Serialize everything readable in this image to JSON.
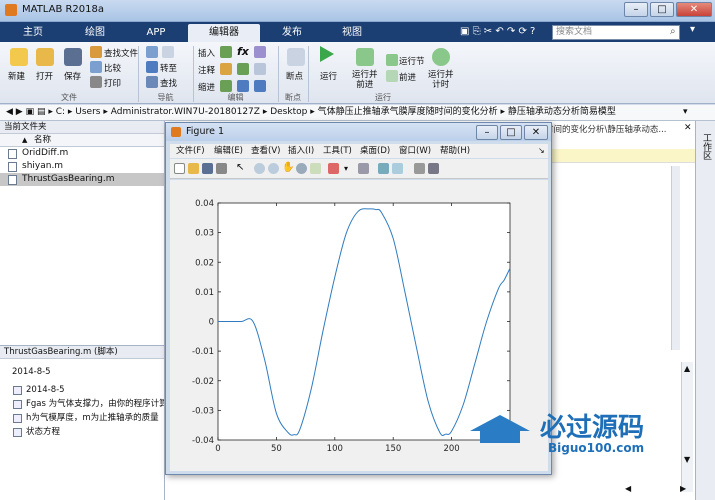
{
  "app": {
    "title": "MATLAB R2018a",
    "window_buttons": [
      "–",
      "□",
      "✕"
    ]
  },
  "tabs": [
    "主页",
    "绘图",
    "APP",
    "编辑器",
    "发布",
    "视图"
  ],
  "active_tab": "编辑器",
  "search": {
    "placeholder": "搜索文档"
  },
  "ribbon": {
    "file_group": {
      "new": "新建",
      "open": "打开",
      "save": "保存",
      "find_files": "查找文件",
      "compare": "比较",
      "print": "打印",
      "label": "文件"
    },
    "nav_group": {
      "goto": "转至",
      "find": "查找",
      "label": "导航"
    },
    "edit_group": {
      "insert": "插入",
      "comment": "注释",
      "indent": "缩进",
      "fx": "fx",
      "label": "编辑"
    },
    "breakpoint_group": {
      "breakpoints": "断点",
      "label": "断点"
    },
    "run_group": {
      "run": "运行",
      "run_and_advance": "运行并\n前进",
      "run_section": "运行节",
      "advance": "前进",
      "run_and_time": "运行并\n计时",
      "label": "运行"
    }
  },
  "address": {
    "segments": [
      "C:",
      "Users",
      "Administrator.WIN7U-20180127Z",
      "Desktop",
      "气体静压止推轴承气膜厚度随时间的变化分析",
      "静压轴承动态分析简易模型"
    ]
  },
  "current_folder": {
    "title": "当前文件夹",
    "column_name": "名称",
    "column_sort": "▲",
    "files": [
      {
        "name": "OridDiff.m",
        "selected": false
      },
      {
        "name": "shiyan.m",
        "selected": false
      },
      {
        "name": "ThrustGasBearing.m",
        "selected": true
      }
    ]
  },
  "details": {
    "title": "ThrustGasBearing.m  (脚本)",
    "first_line": "2014-8-5",
    "items": [
      "2014-8-5",
      "Fgas 为气体支撑力，由你的程序计算出",
      "h为气模厚度，m为止推轴承的质量",
      "状态方程"
    ]
  },
  "editor_tab_text": "时间的变化分析\\静压轴承动态...",
  "side_label": "工作区",
  "figure": {
    "title": "Figure 1",
    "menu": [
      "文件(F)",
      "编辑(E)",
      "查看(V)",
      "插入(I)",
      "工具(T)",
      "桌面(D)",
      "窗口(W)",
      "帮助(H)"
    ],
    "toolbar_icons": [
      "new-figure-icon",
      "open-icon",
      "save-icon",
      "print-icon",
      "select-icon",
      "zoom-in-icon",
      "zoom-out-icon",
      "pan-icon",
      "rotate-icon",
      "data-cursor-icon",
      "brush-icon",
      "link-icon",
      "colorbar-icon",
      "legend-icon",
      "hide-tools-icon",
      "show-tools-icon"
    ]
  },
  "chart_data": {
    "type": "line",
    "title": "",
    "xlabel": "",
    "ylabel": "",
    "xlim": [
      0,
      250
    ],
    "ylim": [
      -0.04,
      0.04
    ],
    "xticks": [
      0,
      50,
      100,
      150,
      200
    ],
    "yticks": [
      0.04,
      0.03,
      0.02,
      0.01,
      0,
      -0.01,
      -0.02,
      -0.03,
      -0.04
    ],
    "ytick_labels": [
      "0.04",
      "0.03",
      "0.02",
      "0.01",
      "0",
      "-0.01",
      "-0.02",
      "-0.03",
      "-0.04"
    ],
    "grid": false,
    "series": [
      {
        "color": "#2f7bbf",
        "x": [
          0,
          10,
          20,
          30,
          40,
          50,
          60,
          65,
          70,
          80,
          90,
          100,
          110,
          120,
          130,
          135,
          140,
          150,
          160,
          170,
          180,
          190,
          195,
          200,
          210,
          220,
          230,
          240,
          245,
          250
        ],
        "y": [
          0,
          0,
          0,
          0,
          -0.013,
          -0.031,
          -0.0375,
          -0.0382,
          -0.0365,
          -0.0225,
          -0.003,
          0.015,
          0.03,
          0.0372,
          0.038,
          0.0378,
          0.0368,
          0.028,
          0.01,
          -0.009,
          -0.027,
          -0.0375,
          -0.038,
          -0.037,
          -0.028,
          -0.014,
          0.0,
          0.011,
          0.014,
          0.018
        ]
      }
    ]
  },
  "watermark": {
    "text": "必过源码",
    "sub": "Biguo100.com"
  }
}
